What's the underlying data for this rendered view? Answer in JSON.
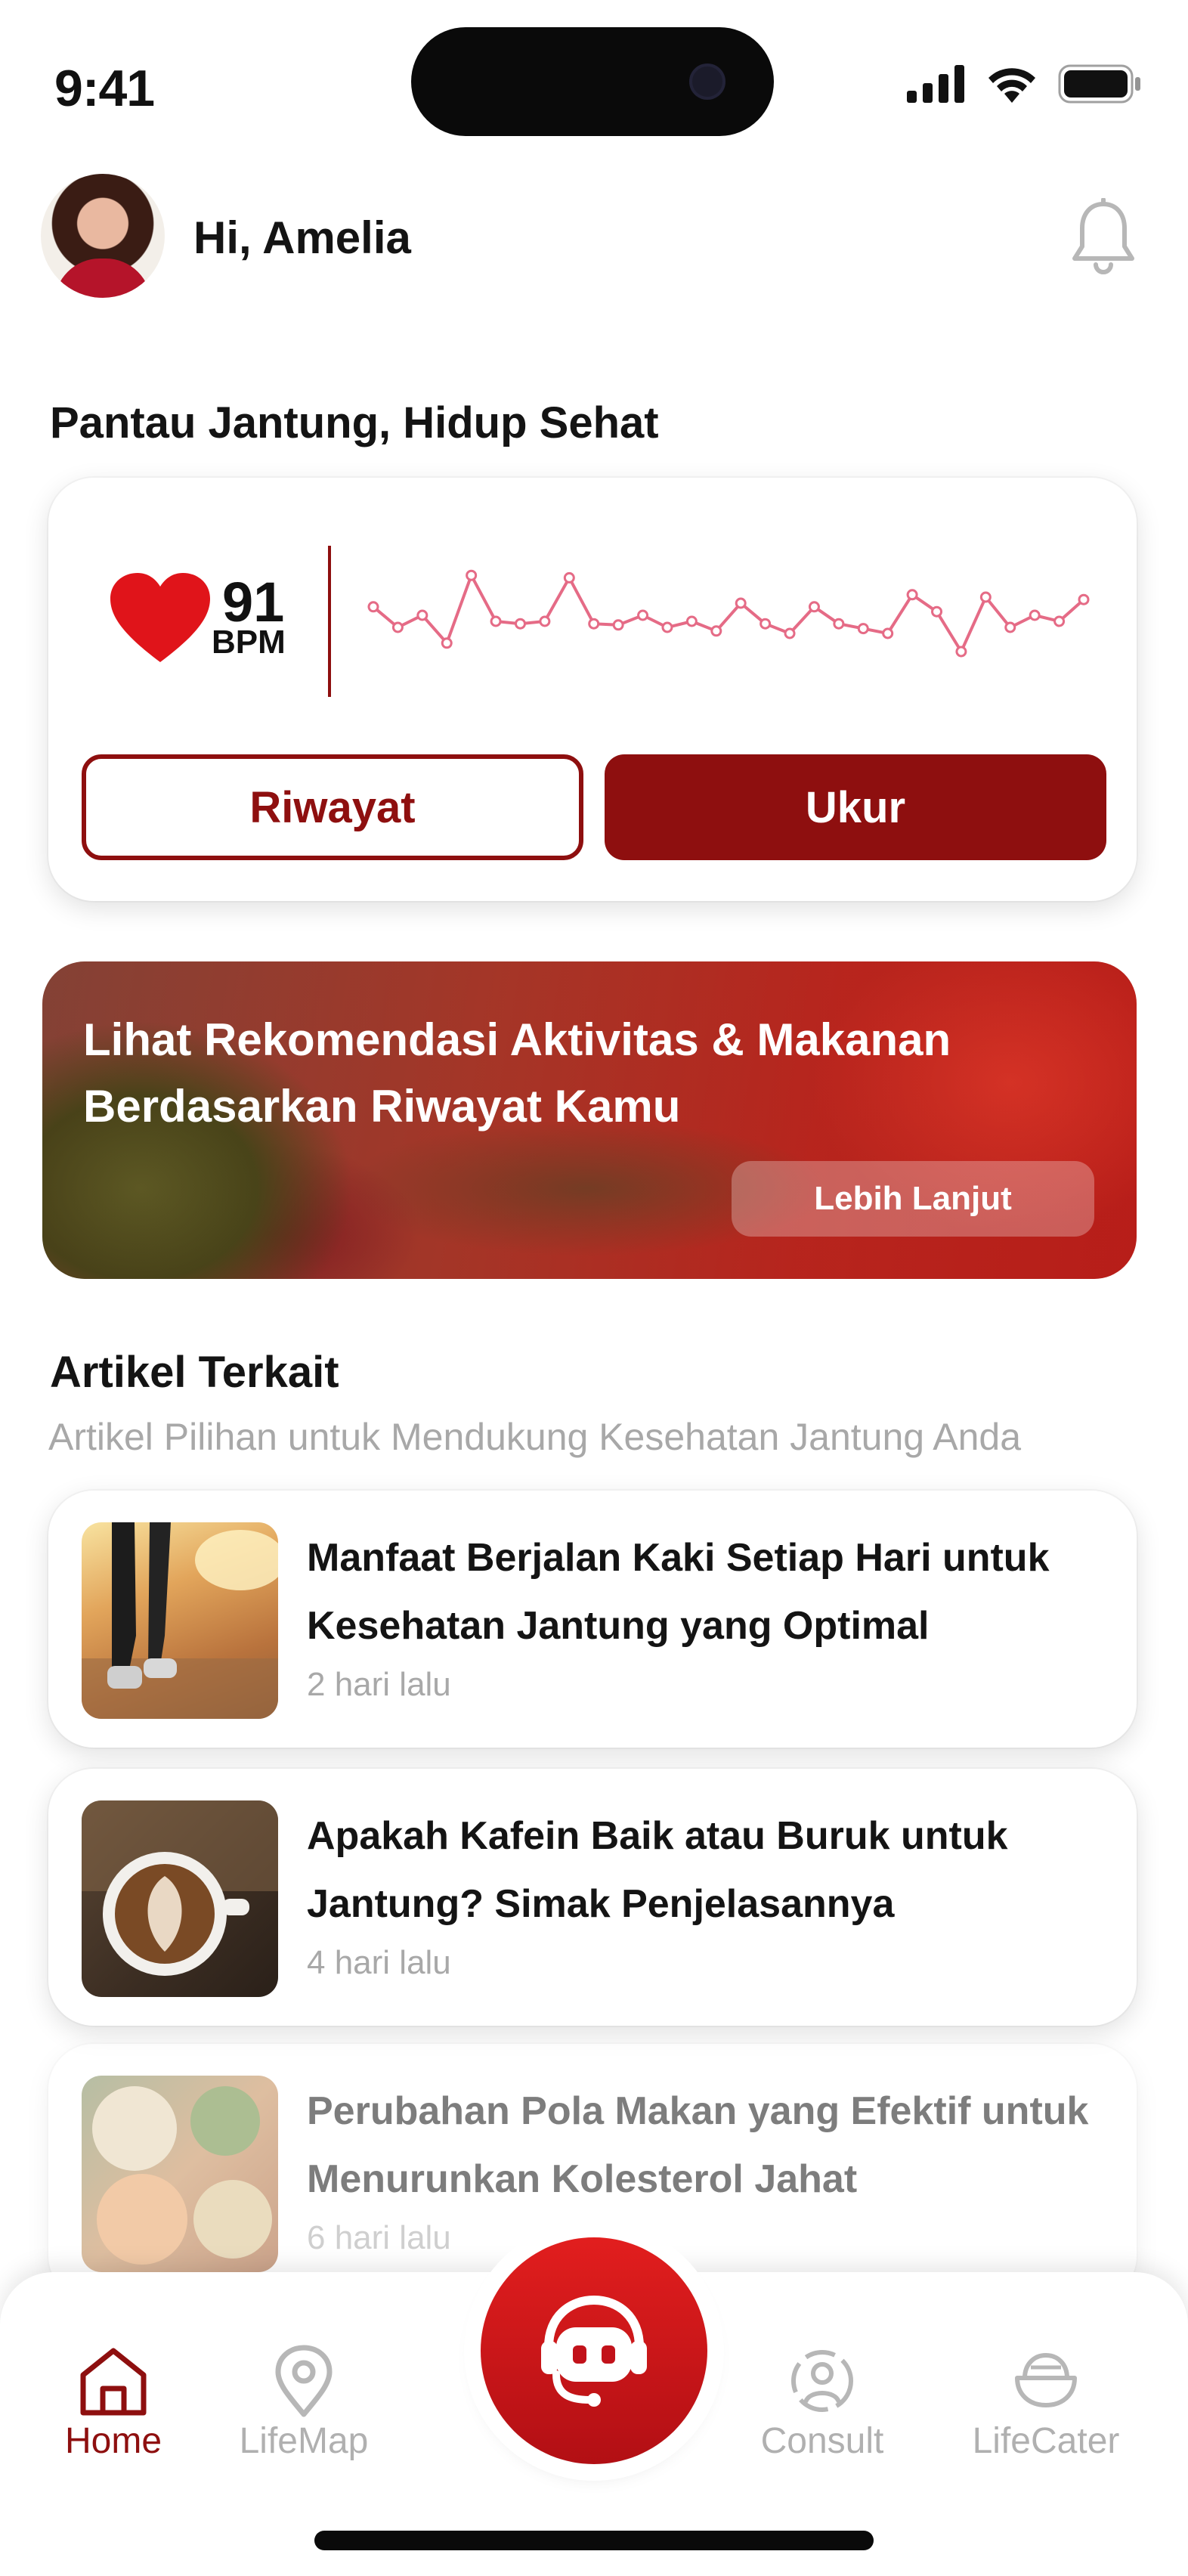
{
  "status_bar": {
    "time": "9:41"
  },
  "header": {
    "greeting": "Hi, Amelia"
  },
  "heart": {
    "section_title": "Pantau Jantung, Hidup Sehat",
    "bpm_value": "91",
    "bpm_unit": "BPM",
    "history_button": "Riwayat",
    "measure_button": "Ukur",
    "trend_values": [
      0.62,
      0.45,
      0.55,
      0.32,
      0.88,
      0.5,
      0.48,
      0.5,
      0.86,
      0.48,
      0.47,
      0.55,
      0.45,
      0.5,
      0.42,
      0.65,
      0.48,
      0.4,
      0.62,
      0.48,
      0.44,
      0.4,
      0.72,
      0.58,
      0.25,
      0.7,
      0.45,
      0.55,
      0.5,
      0.68
    ]
  },
  "banner": {
    "title": "Lihat Rekomendasi Aktivitas & Makanan Berdasarkan Riwayat Kamu",
    "button": "Lebih Lanjut"
  },
  "articles": {
    "section_title": "Artikel Terkait",
    "subtitle": "Artikel Pilihan untuk Mendukung Kesehatan Jantung Anda",
    "items": [
      {
        "title": "Manfaat Berjalan Kaki Setiap Hari untuk Kesehatan Jantung yang Optimal",
        "time": "2 hari lalu"
      },
      {
        "title": "Apakah Kafein Baik atau Buruk untuk Jantung? Simak Penjelasannya",
        "time": "4 hari lalu"
      },
      {
        "title": "Perubahan Pola Makan yang Efektif untuk Menurunkan Kolesterol Jahat",
        "time": "6 hari lalu"
      }
    ]
  },
  "nav": {
    "home": "Home",
    "lifemap": "LifeMap",
    "consult": "Consult",
    "lifecater": "LifeCater",
    "active": "home"
  },
  "colors": {
    "accent": "#8e0f0f",
    "fab": "#d61a1a",
    "muted": "#a8a8a8"
  }
}
